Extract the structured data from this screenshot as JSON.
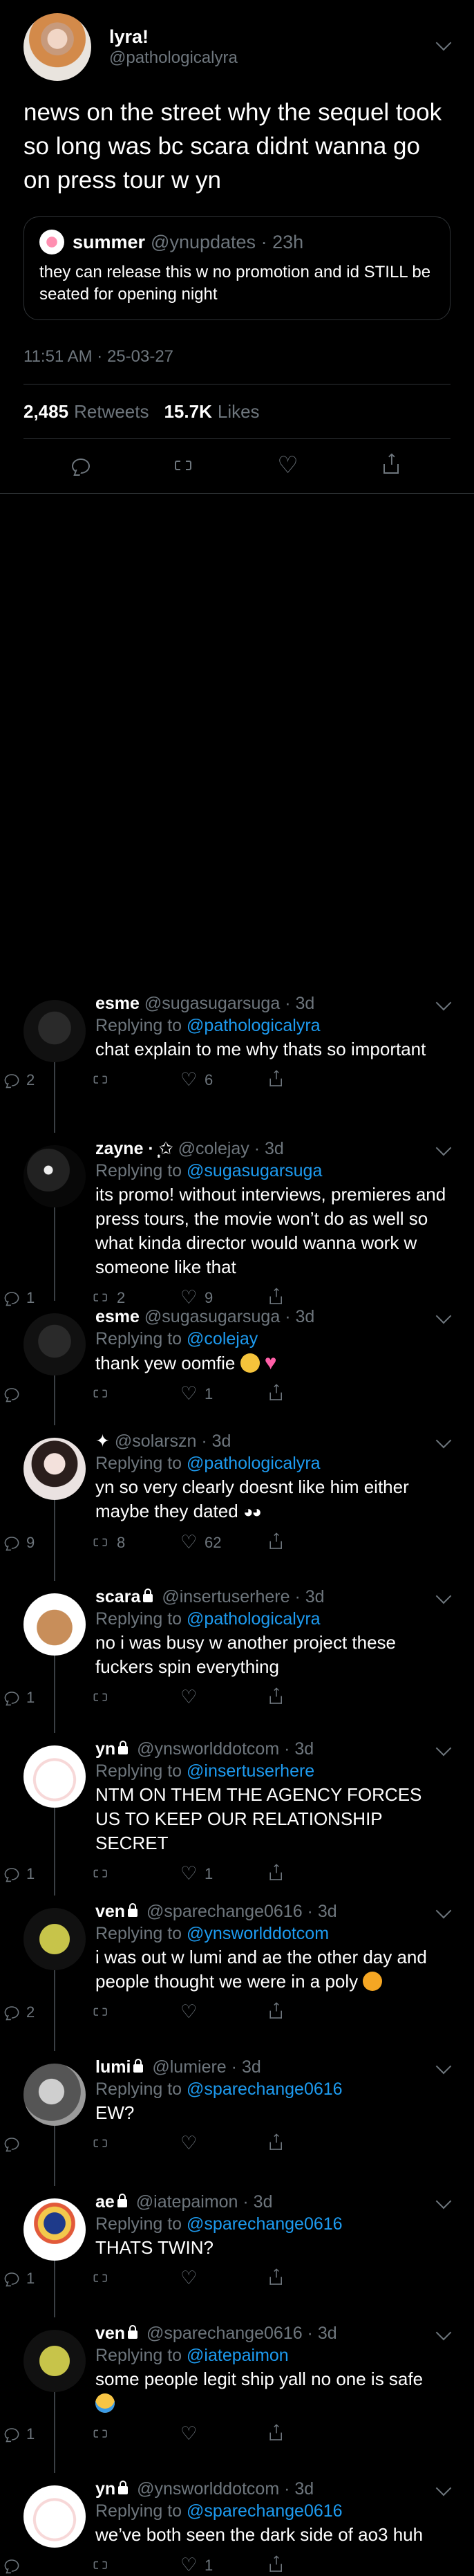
{
  "colors": {
    "background": "#000000",
    "link": "#1d9bf0",
    "muted": "#6e767d",
    "text": "#ffffff"
  },
  "main": {
    "name": "lyra!",
    "handle": "@pathologicalyra",
    "text": "news on the street why the sequel took so long was bc scara didnt wanna go on press tour w yn",
    "quote": {
      "name": "summer",
      "handle": "@ynupdates",
      "time": "23h",
      "text": "they can release this w no promotion and id STILL be seated for opening night"
    },
    "timestamp": "11:51 AM · 25-03-27",
    "retweets": "2,485",
    "retweets_label": "Retweets",
    "likes": "15.7K",
    "likes_label": "Likes"
  },
  "replies": [
    {
      "name": "esme",
      "handle": "@sugasugarsuga",
      "time": "3d",
      "locked": false,
      "replying_label": "Replying to",
      "replying_to": "@pathologicalyra",
      "text": "chat explain to me why thats so important",
      "emoji": "",
      "reply_count": "2",
      "rt_count": "",
      "like_count": "6",
      "avatar": "dark-hands"
    },
    {
      "name": "zayne · ̩͙✩",
      "handle": "@colejay",
      "time": "3d",
      "locked": false,
      "replying_label": "Replying to",
      "replying_to": "@sugasugarsuga",
      "text": "its promo! without interviews, premieres and press tours, the movie won’t do as well so what kinda director would wanna work w someone like that",
      "emoji": "",
      "reply_count": "1",
      "rt_count": "2",
      "like_count": "9",
      "avatar": "dark-figure"
    },
    {
      "name": "esme",
      "handle": "@sugasugarsuga",
      "time": "3d",
      "locked": false,
      "replying_label": "Replying to",
      "replying_to": "@colejay",
      "text": "thank yew oomfie",
      "emoji": "smile-heart",
      "reply_count": "",
      "rt_count": "",
      "like_count": "1",
      "avatar": "dark-hands"
    },
    {
      "name": "✦",
      "handle": "@solarszn",
      "time": "3d",
      "locked": false,
      "replying_label": "Replying to",
      "replying_to": "@pathologicalyra",
      "text": "yn so very clearly doesnt like him either maybe they dated",
      "emoji": "eyes",
      "reply_count": "9",
      "rt_count": "8",
      "like_count": "62",
      "avatar": "girl"
    },
    {
      "name": "scara",
      "handle": "@insertuserhere",
      "time": "3d",
      "locked": true,
      "replying_label": "Replying to",
      "replying_to": "@pathologicalyra",
      "text": "no i was busy w another project these fuckers spin everything",
      "emoji": "",
      "reply_count": "1",
      "rt_count": "",
      "like_count": "",
      "avatar": "bear"
    },
    {
      "name": "yn",
      "handle": "@ynsworlddotcom",
      "time": "3d",
      "locked": true,
      "replying_label": "Replying to",
      "replying_to": "@insertuserhere",
      "text": "NTM ON THEM THE AGENCY FORCES US TO KEEP OUR RELATIONSHIP SECRET",
      "emoji": "",
      "reply_count": "1",
      "rt_count": "",
      "like_count": "1",
      "avatar": "bunny"
    },
    {
      "name": "ven",
      "handle": "@sparechange0616",
      "time": "3d",
      "locked": true,
      "replying_label": "Replying to",
      "replying_to": "@ynsworlddotcom",
      "text": "i was out w lumi and ae the other day and people thought we were in a poly",
      "emoji": "frown",
      "reply_count": "2",
      "rt_count": "",
      "like_count": "",
      "avatar": "frog"
    },
    {
      "name": "lumi",
      "handle": "@lumiere",
      "time": "3d",
      "locked": true,
      "replying_label": "Replying to",
      "replying_to": "@sparechange0616",
      "text": "EW?",
      "emoji": "",
      "reply_count": "",
      "rt_count": "",
      "like_count": "",
      "avatar": "gray"
    },
    {
      "name": "ae",
      "handle": "@iatepaimon",
      "time": "3d",
      "locked": true,
      "replying_label": "Replying to",
      "replying_to": "@sparechange0616",
      "text": "THATS TWIN?",
      "emoji": "",
      "reply_count": "1",
      "rt_count": "",
      "like_count": "",
      "avatar": "bird"
    },
    {
      "name": "ven",
      "handle": "@sparechange0616",
      "time": "3d",
      "locked": true,
      "replying_label": "Replying to",
      "replying_to": "@iatepaimon",
      "text": "some people legit ship yall no one is safe",
      "emoji": "cry",
      "reply_count": "1",
      "rt_count": "",
      "like_count": "",
      "avatar": "frog"
    },
    {
      "name": "yn",
      "handle": "@ynsworlddotcom",
      "time": "3d",
      "locked": true,
      "replying_label": "Replying to",
      "replying_to": "@sparechange0616",
      "text": "we’ve both seen the dark side of ao3 huh",
      "emoji": "",
      "reply_count": "",
      "rt_count": "",
      "like_count": "1",
      "avatar": "bunny"
    }
  ]
}
